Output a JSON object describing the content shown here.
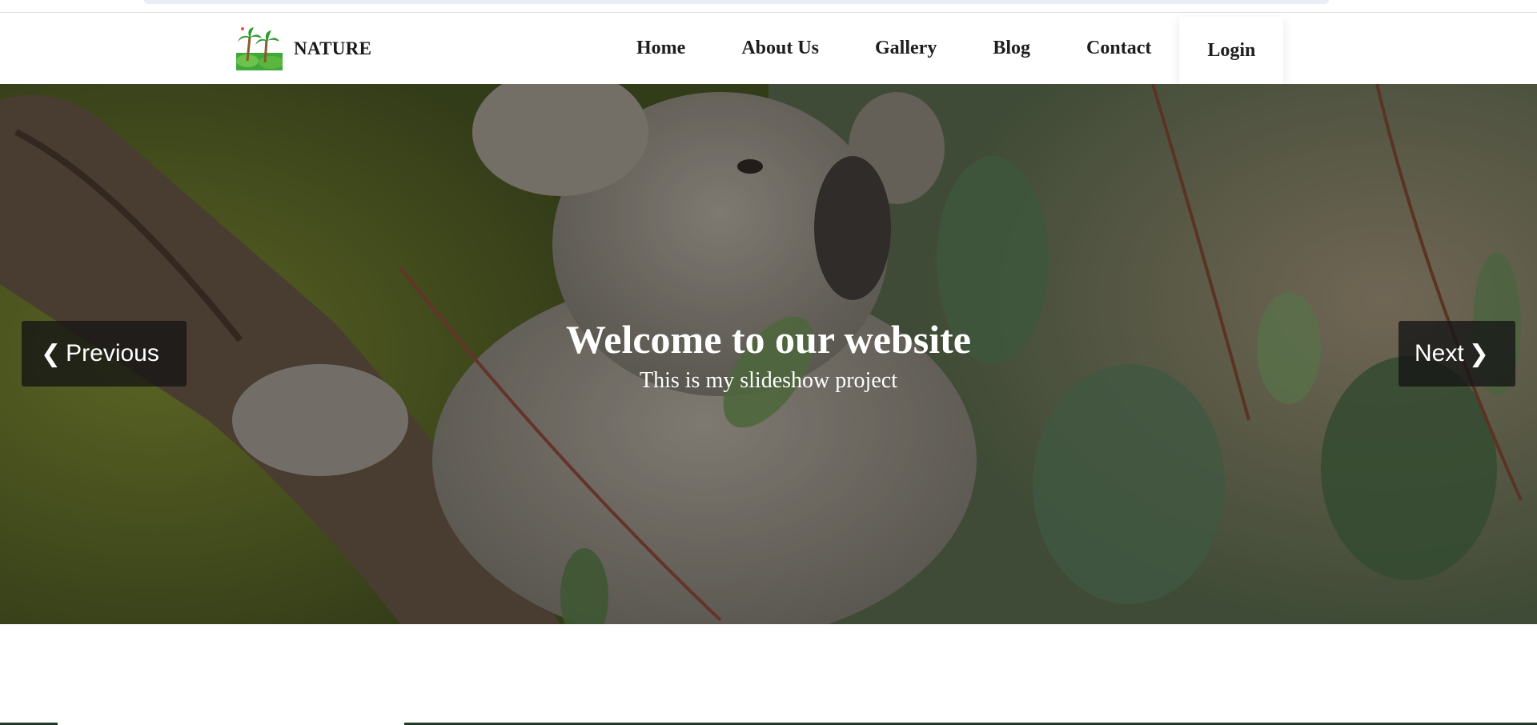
{
  "brand": {
    "name": "NATURE",
    "logo_icon": "palm-trees-logo-icon"
  },
  "nav": {
    "items": [
      {
        "label": "Home"
      },
      {
        "label": "About Us"
      },
      {
        "label": "Gallery"
      },
      {
        "label": "Blog"
      },
      {
        "label": "Contact"
      },
      {
        "label": "Login"
      }
    ]
  },
  "slideshow": {
    "title": "Welcome to our website",
    "subtitle": "This is my slideshow project",
    "prev_label": "Previous",
    "next_label": "Next",
    "prev_icon": "chevron-left-icon",
    "next_icon": "chevron-right-icon"
  },
  "colors": {
    "text_dark": "#1e1e1e",
    "button_bg": "#141414",
    "footer_line": "#1f3a26"
  }
}
